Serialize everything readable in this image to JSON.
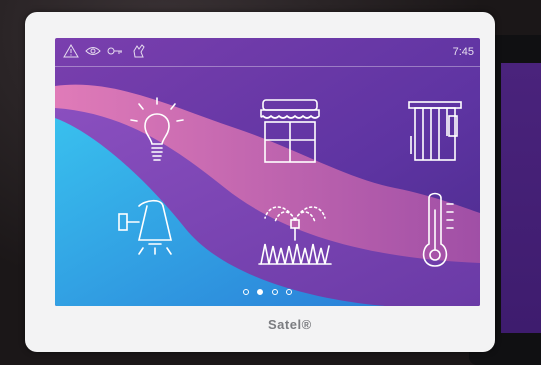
{
  "status_bar": {
    "time": "7:45",
    "icons": [
      "warning-triangle-icon",
      "eye-icon",
      "key-icon",
      "hand-icon"
    ]
  },
  "tiles": [
    {
      "icon": "light-bulb-icon"
    },
    {
      "icon": "awning-window-icon"
    },
    {
      "icon": "blinds-icon"
    },
    {
      "icon": "wall-lamp-icon"
    },
    {
      "icon": "garden-sprinkler-icon"
    },
    {
      "icon": "thermometer-icon"
    }
  ],
  "pager": {
    "pages": 4,
    "active": 2
  },
  "brand": {
    "logo_text": "Satel®"
  },
  "colors": {
    "screen_purple": "#6a3aa6",
    "screen_pink": "#d478b4",
    "screen_cyan": "#3ab8e8",
    "panel_white": "#f3f3f4"
  }
}
